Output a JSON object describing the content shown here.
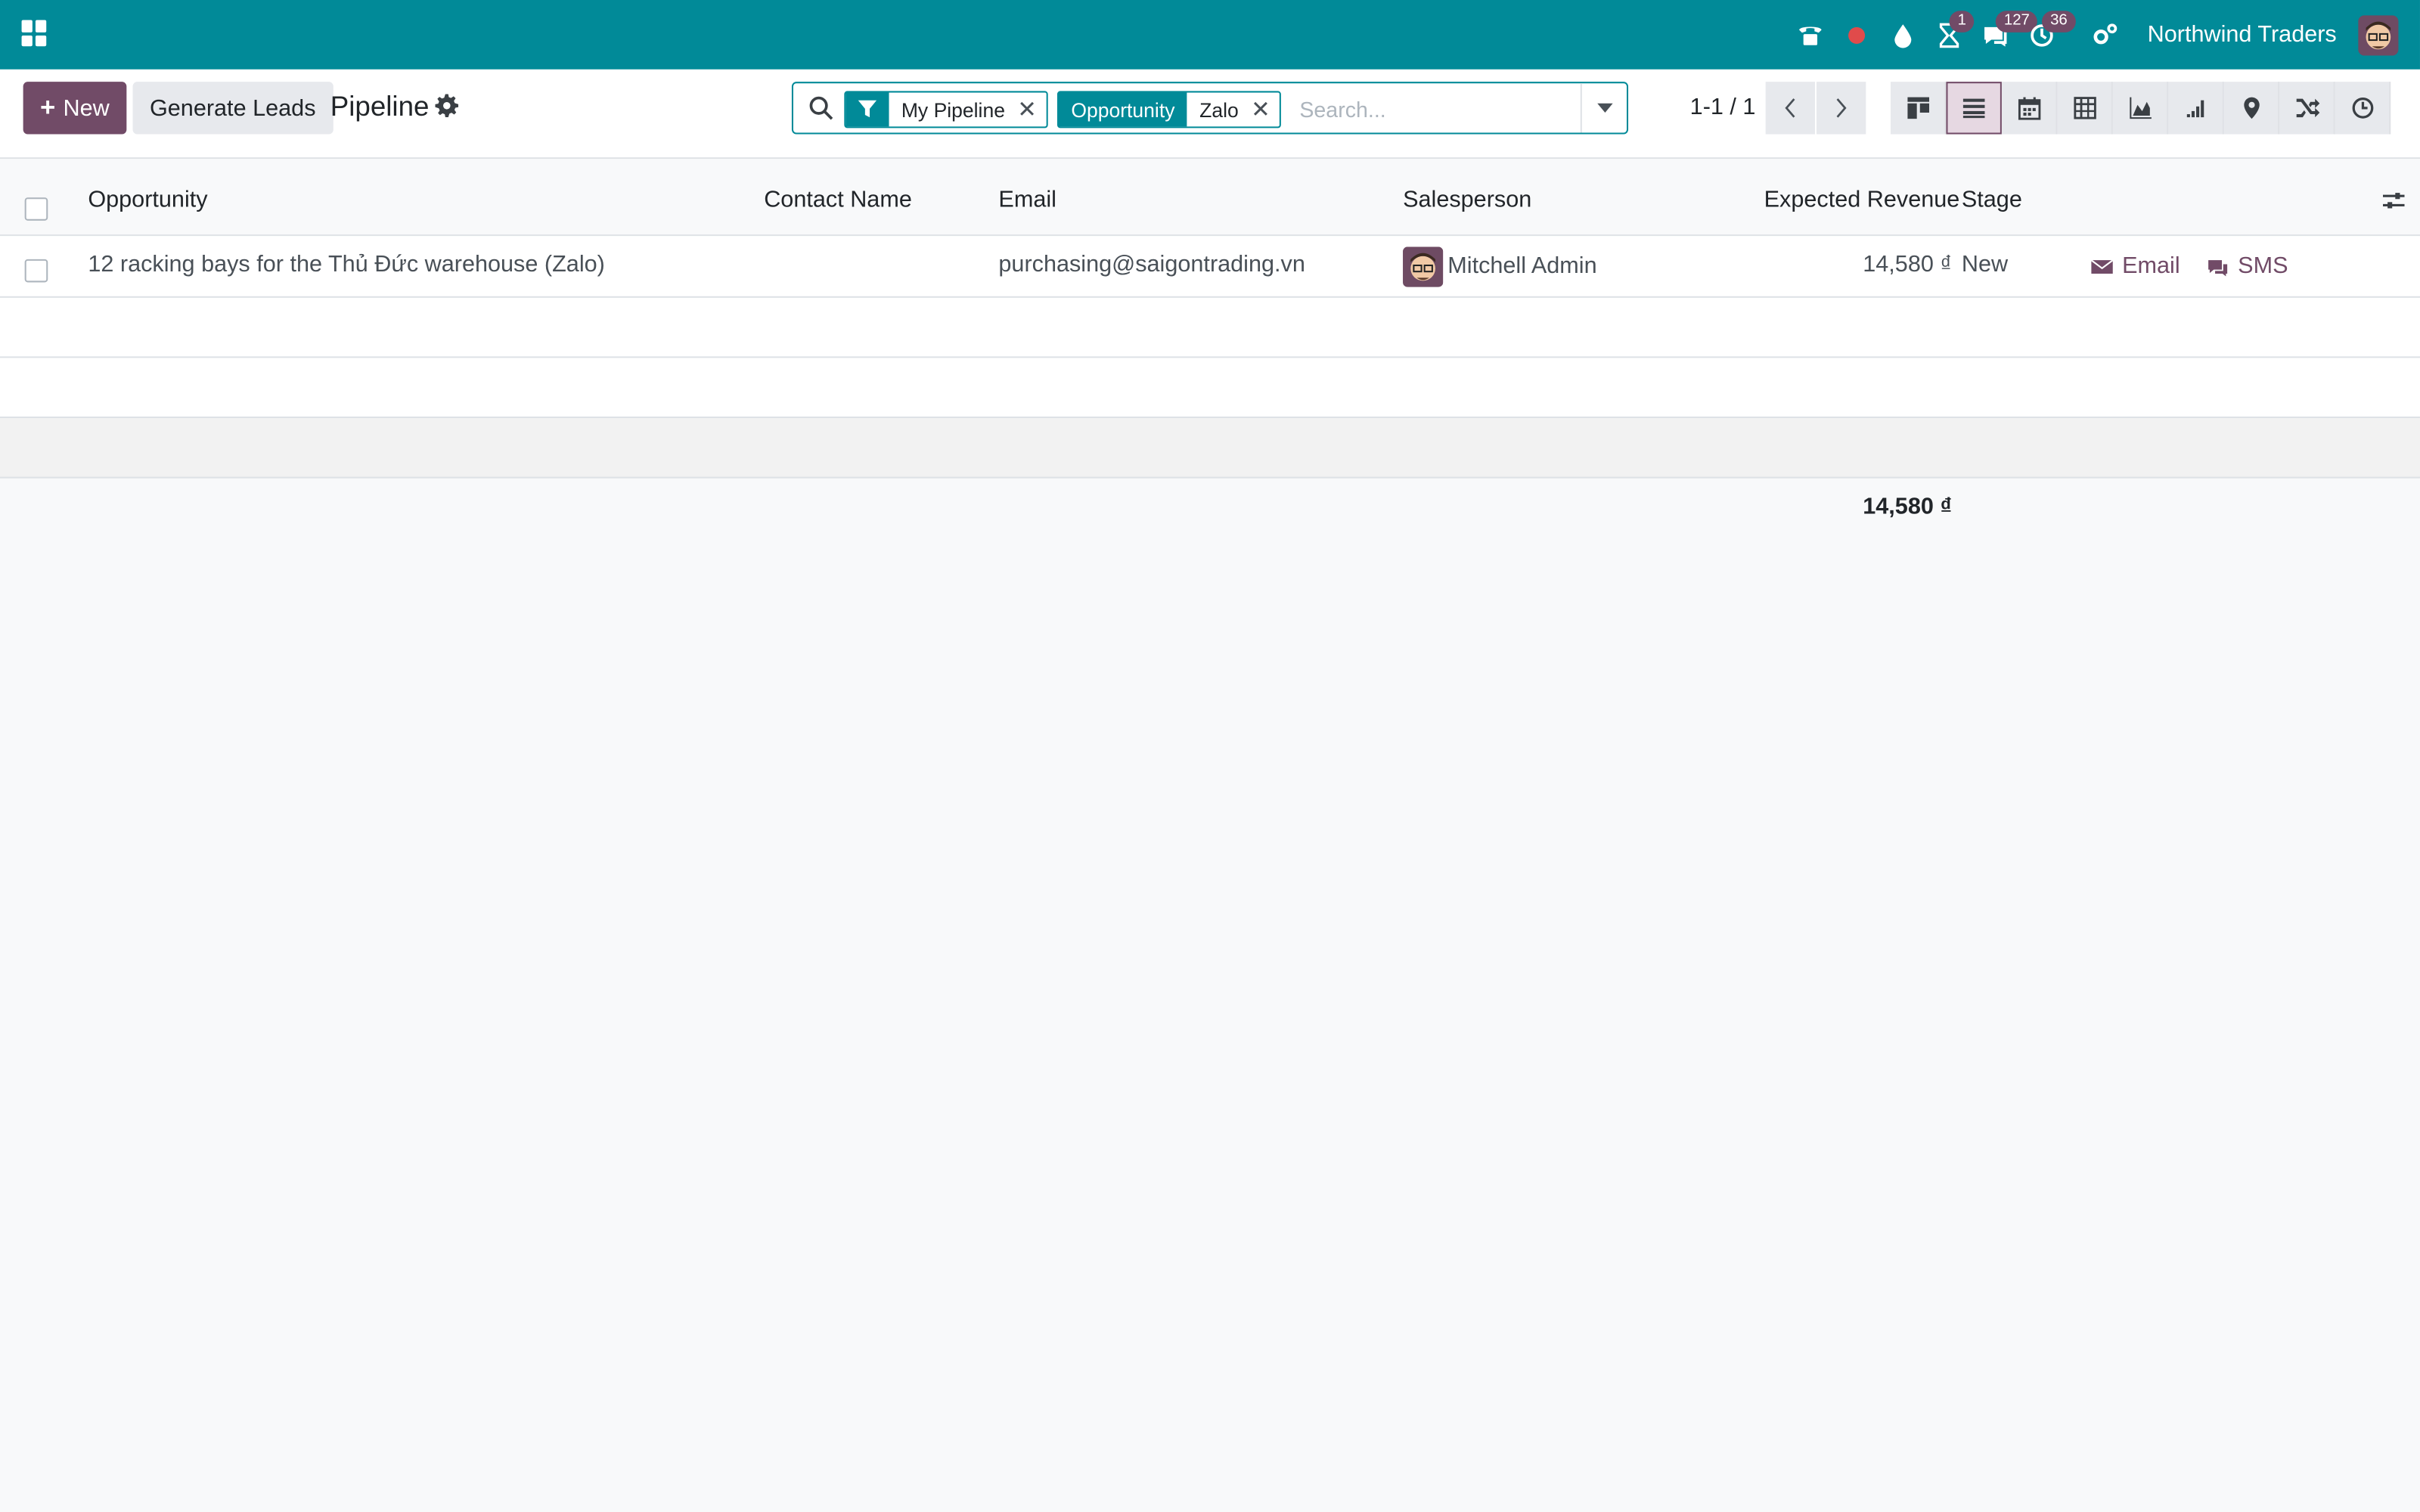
{
  "navbar": {
    "company": "Northwind Traders",
    "badges": {
      "activities": "1",
      "messages": "127",
      "timesheets": "36"
    },
    "icons": [
      "phone-icon",
      "record-icon",
      "drop-icon",
      "hourglass-icon",
      "chat-icon",
      "clock-icon",
      "settings-icon"
    ]
  },
  "control": {
    "new_label": "New",
    "generate_label": "Generate Leads",
    "breadcrumb": "Pipeline"
  },
  "search": {
    "facet1_value": "My Pipeline",
    "facet2_label": "Opportunity",
    "facet2_value": "Zalo",
    "placeholder": "Search..."
  },
  "pager": {
    "text": "1-1 / 1"
  },
  "table": {
    "columns": {
      "opportunity": "Opportunity",
      "contact": "Contact Name",
      "email": "Email",
      "salesperson": "Salesperson",
      "revenue": "Expected Revenue",
      "stage": "Stage"
    },
    "rows": [
      {
        "opportunity": "12 racking bays for the Thủ Đức warehouse (Zalo)",
        "contact": "",
        "email": "purchasing@saigontrading.vn",
        "salesperson": "Mitchell Admin",
        "revenue": "14,580 ₫",
        "stage": "New",
        "action_email": "Email",
        "action_sms": "SMS"
      }
    ],
    "total": "14,580 ₫"
  },
  "colors": {
    "navbar": "#018a98",
    "primary": "#714b67",
    "badge": "#714b67"
  }
}
